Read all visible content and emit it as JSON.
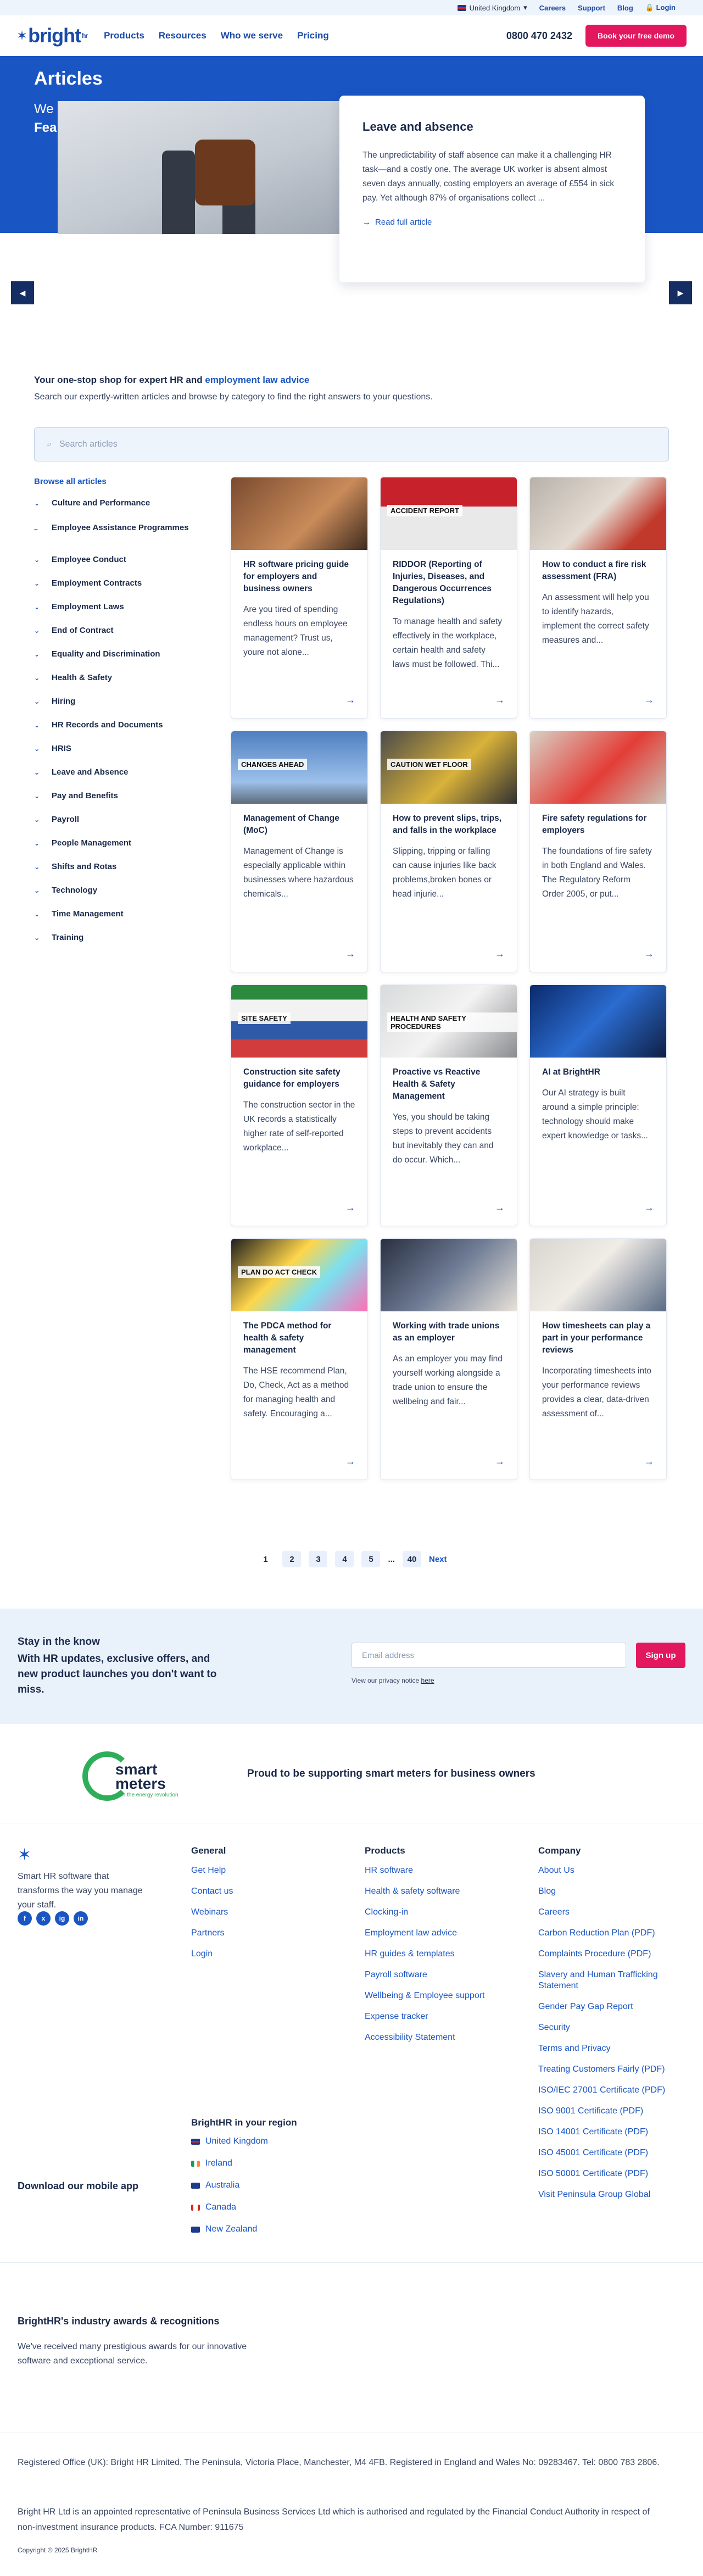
{
  "utility": {
    "region": "United Kingdom",
    "links": [
      "Careers",
      "Support",
      "Blog"
    ],
    "login": "Login"
  },
  "header": {
    "logo_text": "bright",
    "logo_sup": "hr",
    "nav": [
      "Products",
      "Resources",
      "Who we serve",
      "Pricing"
    ],
    "phone": "0800 470 2432",
    "demo_button": "Book your free demo"
  },
  "hero": {
    "title": "Articles",
    "overlay_text": "We",
    "overlay_text_2": "Fea",
    "card_title": "Leave and absence",
    "card_text": "The unpredictability of staff absence can make it a challenging HR task—and a costly one. The average UK worker is absent almost seven days annually, costing employers an average of £554 in sick pay. Yet although 87% of organisations collect ...",
    "read_more": "Read full article"
  },
  "intro": {
    "heading_prefix": "Your one-stop shop for expert HR and ",
    "heading_link": "employment law advice",
    "subtext": "Search our expertly-written articles and browse by category to find the right answers to your questions."
  },
  "search": {
    "placeholder": "Search articles"
  },
  "sidebar": {
    "browse_all": "Browse all articles",
    "categories": [
      "Culture and Performance",
      "Employee Assistance Programmes",
      "Employee Conduct",
      "Employment Contracts",
      "Employment Laws",
      "End of Contract",
      "Equality and Discrimination",
      "Health & Safety",
      "Hiring",
      "HR Records and Documents",
      "HRIS",
      "Leave and Absence",
      "Pay and Benefits",
      "Payroll",
      "People Management",
      "Shifts and Rotas",
      "Technology",
      "Time Management",
      "Training"
    ]
  },
  "articles": [
    {
      "title": "HR software pricing guide for employers and business owners",
      "excerpt": "Are you tired of spending endless hours on employee management? Trust us, youre not alone...",
      "image_label": ""
    },
    {
      "title": "RIDDOR (Reporting of Injuries, Diseases, and Dangerous Occurrences Regulations)",
      "excerpt": "To manage health and safety effectively in the workplace, certain health and safety laws must be followed. Thi...",
      "image_label": "ACCIDENT REPORT"
    },
    {
      "title": "How to conduct a fire risk assessment (FRA)",
      "excerpt": "An assessment will help you to identify hazards, implement the correct safety measures and...",
      "image_label": ""
    },
    {
      "title": "Management of Change (MoC)",
      "excerpt": "Management of Change is especially applicable within businesses where hazardous chemicals...",
      "image_label": "CHANGES AHEAD"
    },
    {
      "title": "How to prevent slips, trips, and falls in the workplace",
      "excerpt": "Slipping, tripping or falling can cause injuries like back problems,broken bones or head injurie...",
      "image_label": "CAUTION WET FLOOR"
    },
    {
      "title": "Fire safety regulations for employers",
      "excerpt": "The foundations of fire safety in both England and Wales. The Regulatory Reform Order 2005, or put...",
      "image_label": ""
    },
    {
      "title": "Construction site safety guidance for employers",
      "excerpt": "The construction sector in the UK records a statistically higher rate of self-reported workplace...",
      "image_label": "SITE SAFETY"
    },
    {
      "title": "Proactive vs Reactive Health & Safety Management",
      "excerpt": "Yes, you should be taking steps to prevent accidents but inevitably they can and do occur. Which...",
      "image_label": "HEALTH AND SAFETY PROCEDURES"
    },
    {
      "title": "AI at BrightHR",
      "excerpt": "Our AI strategy is built around a simple principle: technology should make expert knowledge or tasks...",
      "image_label": ""
    },
    {
      "title": "The PDCA method for health & safety management",
      "excerpt": "The HSE recommend Plan, Do, Check, Act as a method for managing health and safety. Encouraging a...",
      "image_label": "PLAN DO ACT CHECK"
    },
    {
      "title": "Working with trade unions as an employer",
      "excerpt": "As an employer you may find yourself working alongside a trade union to ensure the wellbeing and fair...",
      "image_label": ""
    },
    {
      "title": "How timesheets can play a part in your performance reviews",
      "excerpt": "Incorporating timesheets into your performance reviews provides a clear, data-driven assessment of...",
      "image_label": ""
    }
  ],
  "pagination": {
    "pages": [
      "1",
      "2",
      "3",
      "4",
      "5",
      "40"
    ],
    "ellipsis": "...",
    "next": "Next"
  },
  "newsletter": {
    "title": "Stay in the know",
    "subtitle": "With HR updates, exclusive offers, and new product launches you don't want to miss.",
    "placeholder": "Email address",
    "button": "Sign up",
    "privacy_prefix": "View our privacy notice ",
    "privacy_link": "here"
  },
  "smart_meters": {
    "logo_text": "smart meters",
    "logo_sub": "Join the energy revolution",
    "text": "Proud to be supporting smart meters for business owners"
  },
  "footer": {
    "tagline": "Smart HR software that transforms the way you manage your staff.",
    "social": [
      "f",
      "x",
      "ig",
      "in"
    ],
    "general": {
      "title": "General",
      "links": [
        "Get Help",
        "Contact us",
        "Webinars",
        "Partners",
        "Login"
      ]
    },
    "products": {
      "title": "Products",
      "links": [
        "HR software",
        "Health & safety software",
        "Clocking-in",
        "Employment law advice",
        "HR guides & templates",
        "Payroll software",
        "Wellbeing & Employee support",
        "Expense tracker",
        "Accessibility Statement"
      ]
    },
    "company": {
      "title": "Company",
      "links": [
        "About Us",
        "Blog",
        "Careers",
        "Carbon Reduction Plan (PDF)",
        "Complaints Procedure (PDF)",
        "Slavery and Human Trafficking Statement",
        "Gender Pay Gap Report",
        "Security",
        "Terms and Privacy",
        "Treating Customers Fairly (PDF)",
        "ISO/IEC 27001 Certificate (PDF)",
        "ISO 9001 Certificate (PDF)",
        "ISO 14001 Certificate (PDF)",
        "ISO 45001 Certificate (PDF)",
        "ISO 50001 Certificate (PDF)",
        "Visit Peninsula Group Global"
      ]
    },
    "region_title": "BrightHR in your region",
    "regions": [
      "United Kingdom",
      "Ireland",
      "Australia",
      "Canada",
      "New Zealand"
    ],
    "download": "Download our mobile app"
  },
  "awards": {
    "title": "BrightHR's industry awards & recognitions",
    "text": "We've received many prestigious awards for our innovative software and exceptional service."
  },
  "legal": {
    "line1": "Registered Office (UK): Bright HR Limited, The Peninsula, Victoria Place, Manchester, M4 4FB. Registered in England and Wales No: 09283467. Tel: 0800 783 2806.",
    "line2": "Bright HR Ltd is an appointed representative of Peninsula Business Services Ltd which is authorised and regulated by the Financial Conduct Authority in respect of non-investment insurance products. FCA Number: 911675",
    "copyright": "Copyright © 2025 BrightHR"
  },
  "colors": {
    "brand_blue": "#1a55c4",
    "accent_pink": "#e2175d",
    "navy": "#1b2a4a"
  }
}
